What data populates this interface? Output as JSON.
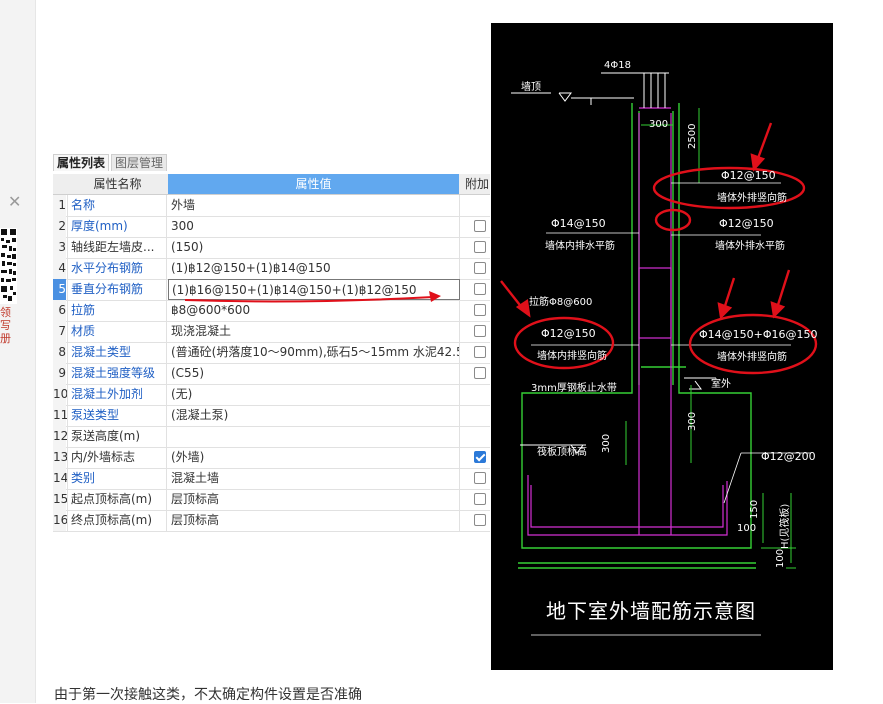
{
  "sidebar": {
    "close_glyph": "✕",
    "text": "领\n写\n册"
  },
  "tabs": [
    {
      "label": "属性列表",
      "active": true
    },
    {
      "label": "图层管理",
      "active": false
    }
  ],
  "grid": {
    "headers": {
      "name": "属性名称",
      "value": "属性值",
      "extra": "附加"
    },
    "rows": [
      {
        "num": "1",
        "name": "名称",
        "value": "外墙",
        "blue": true,
        "checkbox": "none"
      },
      {
        "num": "2",
        "name": "厚度(mm)",
        "value": "300",
        "blue": true,
        "checkbox": "off"
      },
      {
        "num": "3",
        "name": "轴线距左墙皮...",
        "value": "(150)",
        "blue": false,
        "checkbox": "off"
      },
      {
        "num": "4",
        "name": "水平分布钢筋",
        "value": "(1)฿12@150+(1)฿14@150",
        "blue": true,
        "checkbox": "off"
      },
      {
        "num": "5",
        "name": "垂直分布钢筋",
        "value": "(1)฿16@150+(1)฿14@150+(1)฿12@150",
        "blue": true,
        "checkbox": "off",
        "selected": true
      },
      {
        "num": "6",
        "name": "拉筋",
        "value": "฿8@600*600",
        "blue": true,
        "checkbox": "off"
      },
      {
        "num": "7",
        "name": "材质",
        "value": "现浇混凝土",
        "blue": true,
        "checkbox": "off"
      },
      {
        "num": "8",
        "name": "混凝土类型",
        "value": "(普通砼(坍落度10～90mm),砾石5～15mm 水泥42.5)",
        "blue": true,
        "checkbox": "off"
      },
      {
        "num": "9",
        "name": "混凝土强度等级",
        "value": "(C55)",
        "blue": true,
        "checkbox": "off"
      },
      {
        "num": "10",
        "name": "混凝土外加剂",
        "value": "(无)",
        "blue": true,
        "checkbox": "none"
      },
      {
        "num": "11",
        "name": "泵送类型",
        "value": "(混凝土泵)",
        "blue": true,
        "checkbox": "none"
      },
      {
        "num": "12",
        "name": "泵送高度(m)",
        "value": "",
        "blue": false,
        "checkbox": "none"
      },
      {
        "num": "13",
        "name": "内/外墙标志",
        "value": "(外墙)",
        "blue": false,
        "checkbox": "on"
      },
      {
        "num": "14",
        "name": "类别",
        "value": "混凝土墙",
        "blue": true,
        "checkbox": "off"
      },
      {
        "num": "15",
        "name": "起点顶标高(m)",
        "value": "层顶标高",
        "blue": false,
        "checkbox": "off"
      },
      {
        "num": "16",
        "name": "终点顶标高(m)",
        "value": "层顶标高",
        "blue": false,
        "checkbox": "off"
      }
    ]
  },
  "drawing": {
    "title": "地下室外墙配筋示意图",
    "labels": {
      "top_bars": "4Φ18",
      "slab": "墙顶",
      "width300": "300",
      "dim2500": "2500",
      "outer_vert_label_1": "Φ12@150",
      "outer_vert_label_2": "墙体外排竖向筋",
      "inner_horiz_1": "Φ14@150",
      "inner_horiz_2": "墙体内排水平筋",
      "outer_horiz_1": "Φ12@150",
      "outer_horiz_2": "墙体外排水平筋",
      "tie": "拉筋Φ8@600",
      "inner_vert_1": "Φ12@150",
      "inner_vert_2": "墙体内排竖向筋",
      "outer_vert2_1": "Φ14@150+Φ16@150",
      "outer_vert2_2": "墙体外排竖向筋",
      "waterstop": "3mm厚钢板止水带",
      "outside": "室外",
      "found_top": "筏板顶标高",
      "dim300a": "300",
      "dim300b": "300",
      "found_bar": "Φ12@200",
      "dim150": "150",
      "dim_h": "H(见筏板)",
      "dim100a": "100",
      "dim100b": "100"
    }
  },
  "caption": "由于第一次接触这类，不太确定构件设置是否准确",
  "colors": {
    "header_blue": "#61a8ef",
    "annotation_red": "#e0101a",
    "rebar_magenta": "#d430d4",
    "concrete_green": "#35d035"
  }
}
